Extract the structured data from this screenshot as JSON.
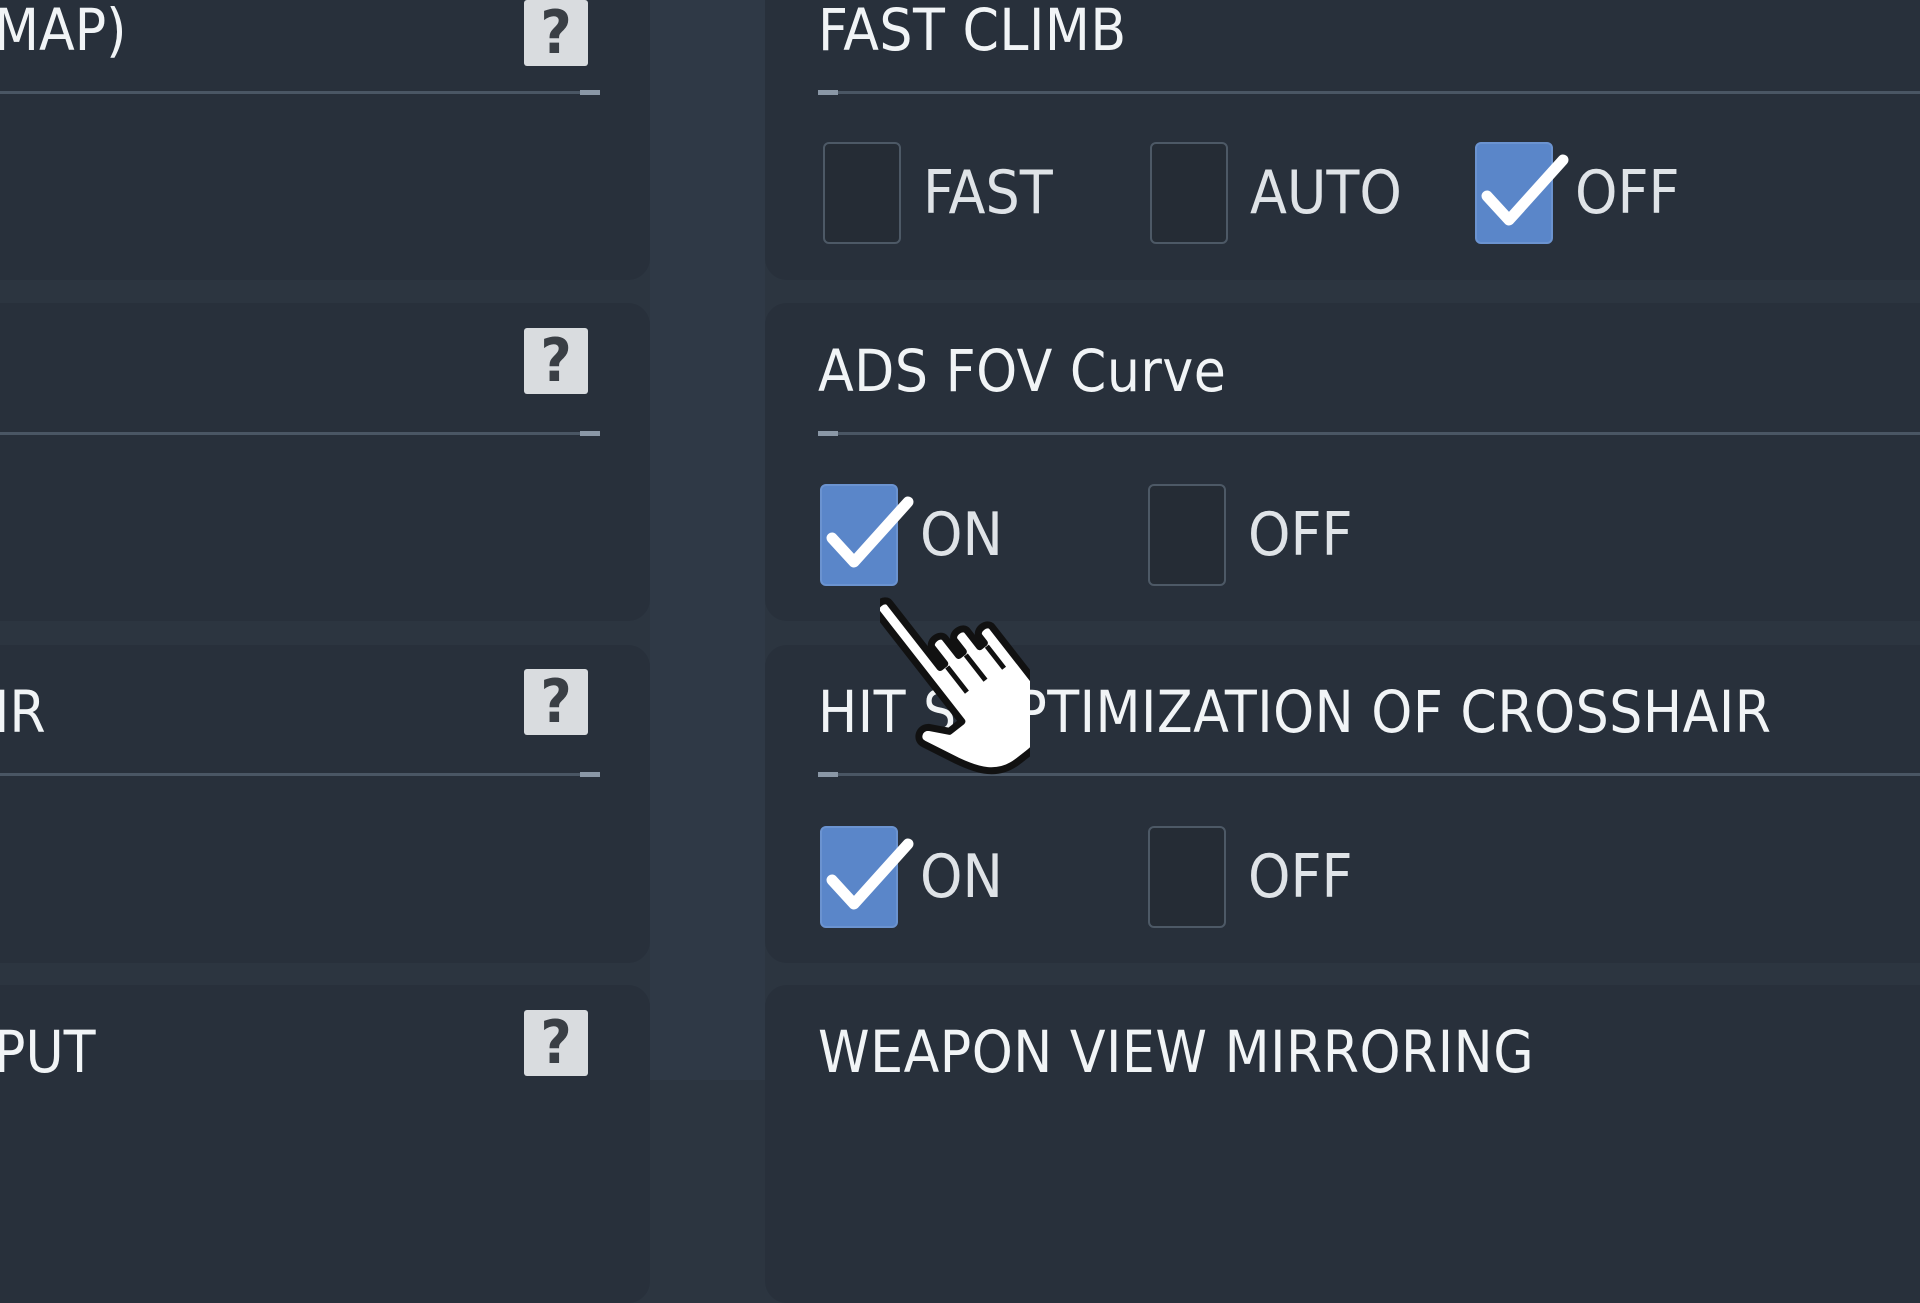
{
  "left_column": {
    "rows": [
      {
        "label": "MAP)"
      },
      {
        "label": ""
      },
      {
        "label": "IR"
      },
      {
        "label": "PUT"
      }
    ],
    "help_glyph": "?"
  },
  "settings": {
    "fast_climb": {
      "title": "FAST CLIMB",
      "options": [
        {
          "label": "FAST",
          "checked": false
        },
        {
          "label": "AUTO",
          "checked": false
        },
        {
          "label": "OFF",
          "checked": true
        }
      ]
    },
    "ads_fov_curve": {
      "title": "ADS FOV Curve",
      "options": [
        {
          "label": "ON",
          "checked": true
        },
        {
          "label": "OFF",
          "checked": false
        }
      ]
    },
    "hitbox_optimization": {
      "title": "HIT S OPTIMIZATION OF CROSSHAIR",
      "options": [
        {
          "label": "ON",
          "checked": true
        },
        {
          "label": "OFF",
          "checked": false
        }
      ]
    },
    "weapon_view_mirroring": {
      "title": "WEAPON VIEW MIRRORING"
    }
  },
  "colors": {
    "background": "#2c3540",
    "panel": "#28303b",
    "checked_box": "#5a86c9",
    "text": "#e8ecef"
  },
  "icons": {
    "help": "question-mark-icon",
    "checkmark": "checkmark-icon",
    "cursor": "hand-pointer-icon"
  }
}
